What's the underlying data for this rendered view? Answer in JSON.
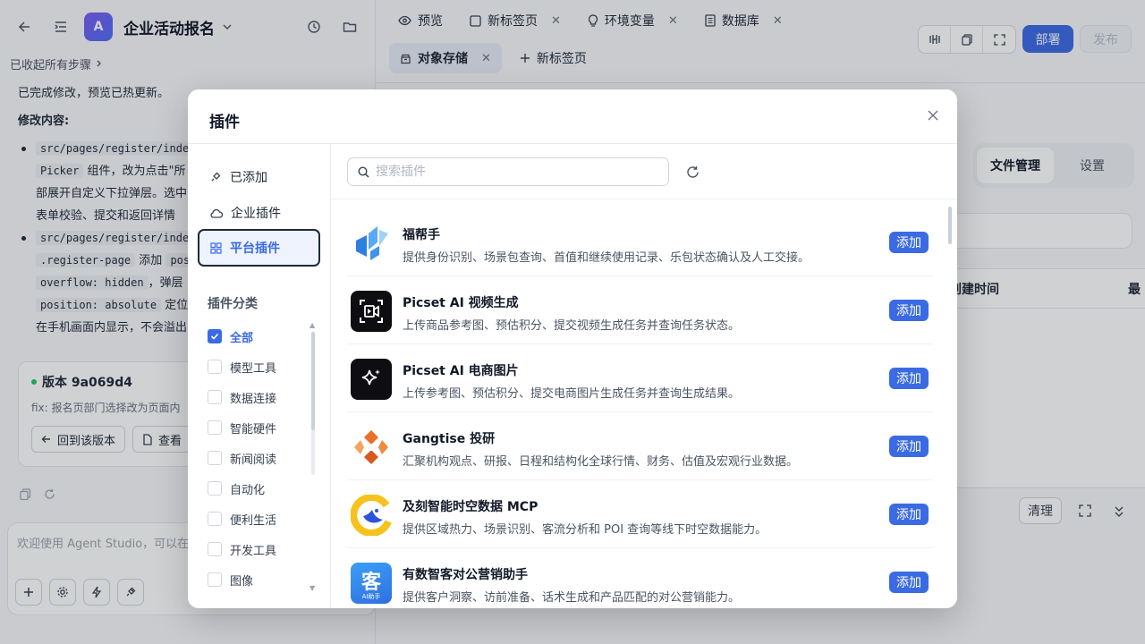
{
  "left": {
    "app_avatar": "A",
    "app_title": "企业活动报名",
    "collapsed_label": "已收起所有步骤",
    "msg_done": "已完成修改，预览已热更新。",
    "msg_changes": "修改内容:",
    "bullet1_code1": "src/pages/register/inde",
    "bullet1_code2": "Picker",
    "bullet1_text1": "组件，改为点击\"所",
    "bullet1_text2": "部展开自定义下拉弹层。选中",
    "bullet1_text3": "表单校验、提交和返回详情",
    "bullet2_code1": "src/pages/register/inde",
    "bullet2_code2": ".register-page",
    "bullet2_text1": "添加",
    "bullet2_code3": "pos",
    "bullet2_code4": "overflow: hidden",
    "bullet2_text2": "，弹层",
    "bullet2_code5": "position: absolute",
    "bullet2_text3": "定位",
    "bullet2_text4": "在手机画面内显示，不会溢出",
    "version_title": "版本 9a069d4",
    "version_desc": "fix: 报名页部门选择改为页面内",
    "rollback_label": "回到该版本",
    "view_label": "查看",
    "composer_placeholder": "欢迎使用 Agent Studio，可以在"
  },
  "right": {
    "tabs_row1": [
      {
        "label": "预览",
        "icon": "eye-icon",
        "closable": false
      },
      {
        "label": "新标签页",
        "icon": "square-icon",
        "closable": true
      },
      {
        "label": "环境变量",
        "icon": "bulb-icon",
        "closable": true
      },
      {
        "label": "数据库",
        "icon": "database-icon",
        "closable": true
      }
    ],
    "tab_object_storage": "对象存储",
    "tab_new": "新标签页",
    "deploy_label": "部署",
    "publish_label": "发布",
    "seg_files": "文件管理",
    "seg_settings": "设置",
    "col_created": "创建时间",
    "col_last": "最",
    "clear_label": "清理"
  },
  "modal": {
    "title": "插件",
    "nav": [
      {
        "label": "已添加",
        "icon": "plug-icon"
      },
      {
        "label": "企业插件",
        "icon": "cloud-icon"
      },
      {
        "label": "平台插件",
        "icon": "grid-icon"
      }
    ],
    "category_title": "插件分类",
    "categories": [
      "全部",
      "模型工具",
      "数据连接",
      "智能硬件",
      "新闻阅读",
      "自动化",
      "便利生活",
      "开发工具",
      "图像"
    ],
    "search_placeholder": "搜索插件",
    "add_label": "添加",
    "plugins": [
      {
        "name": "福帮手",
        "desc": "提供身份识别、场景包查询、首值和继续使用记录、乐包状态确认及人工交接。"
      },
      {
        "name": "Picset AI 视频生成",
        "desc": "上传商品参考图、预估积分、提交视频生成任务并查询任务状态。"
      },
      {
        "name": "Picset AI 电商图片",
        "desc": "上传参考图、预估积分、提交电商图片生成任务并查询生成结果。"
      },
      {
        "name": "Gangtise 投研",
        "desc": "汇聚机构观点、研报、日程和结构化全球行情、财务、估值及宏观行业数据。"
      },
      {
        "name": "及刻智能时空数据 MCP",
        "desc": "提供区域热力、场景识别、客流分析和 POI 查询等线下时空数据能力。"
      },
      {
        "name": "有数智客对公营销助手",
        "desc": "提供客户洞察、访前准备、话术生成和产品匹配的对公营销能力。"
      }
    ],
    "logo_text": "AI助手",
    "colors": {
      "accent": "#3b6be3",
      "selected_border": "#1e2a3a"
    }
  }
}
